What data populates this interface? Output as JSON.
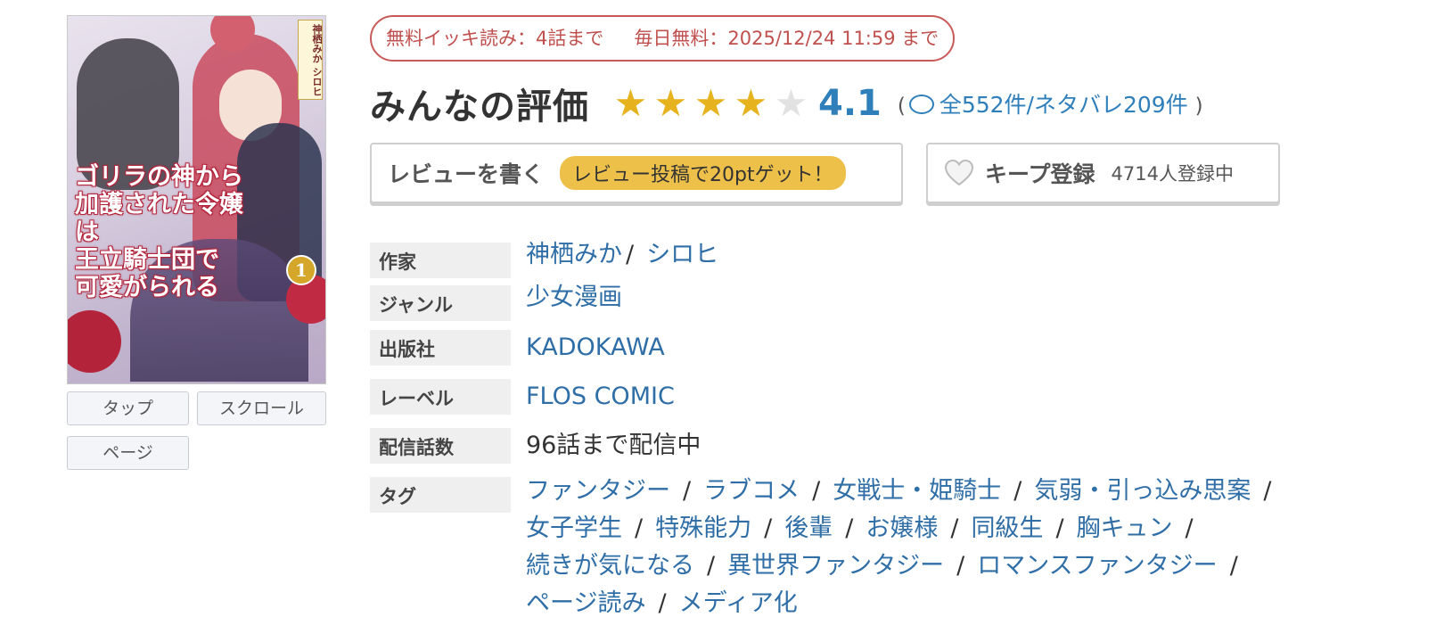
{
  "cover": {
    "title_lines": [
      "ゴリラの神から",
      "加護された令嬢は",
      "王立騎士団で",
      "可愛がられる"
    ],
    "volume": "1",
    "authors_small": "神栖みか シロヒ"
  },
  "view_buttons": [
    "タップ",
    "スクロール",
    "ページ"
  ],
  "free_banner": {
    "ikki": "無料イッキ読み：4話まで",
    "daily": "毎日無料：2025/12/24 11:59 まで"
  },
  "rating": {
    "title": "みんなの評価",
    "score": "4.1",
    "stars_filled": 4,
    "stars_total": 5,
    "review_text": "全552件/ネタバレ209件",
    "open_paren": "(",
    "close_paren": ")",
    "star_color": "#e6b31e"
  },
  "write_review": {
    "label": "レビューを書く",
    "badge": "レビュー投稿で20ptゲット！"
  },
  "keep": {
    "label": "キープ登録",
    "count": "4714人登録中"
  },
  "info": {
    "author_label": "作家",
    "authors": [
      "神栖みか",
      "シロヒ"
    ],
    "author_sep": "/",
    "genre_label": "ジャンル",
    "genre": "少女漫画",
    "publisher_label": "出版社",
    "publisher": "KADOKAWA",
    "label_label": "レーベル",
    "label": "FLOS COMIC",
    "episodes_label": "配信話数",
    "episodes": "96話まで配信中",
    "tags_label": "タグ",
    "tag_sep": "/",
    "tags": [
      "ファンタジー",
      "ラブコメ",
      "女戦士・姫騎士",
      "気弱・引っ込み思案",
      "女子学生",
      "特殊能力",
      "後輩",
      "お嬢様",
      "同級生",
      "胸キュン",
      "続きが気になる",
      "異世界ファンタジー",
      "ロマンスファンタジー",
      "ページ読み",
      "メディア化"
    ]
  }
}
